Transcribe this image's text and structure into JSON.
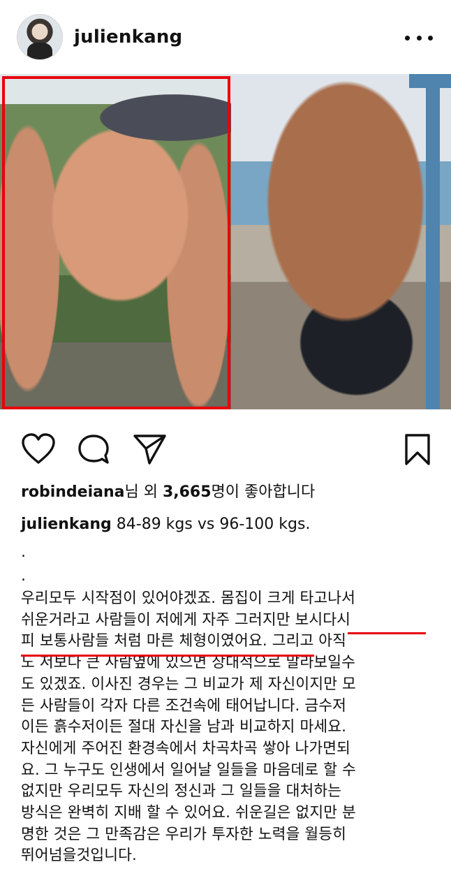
{
  "post": {
    "username": "julienkang",
    "more_icon": "more-horizontal-icon"
  },
  "photos": {
    "left_alt": "before",
    "right_alt": "after",
    "highlight_color": "#e8000c"
  },
  "actions": {
    "like_icon": "heart-outline-icon",
    "comment_icon": "comment-bubble-icon",
    "share_icon": "paper-plane-icon",
    "save_icon": "bookmark-outline-icon"
  },
  "likes": {
    "user": "robindeiana",
    "middle": "님 외 ",
    "count": "3,665",
    "suffix": "명이 좋아합니다"
  },
  "caption": {
    "author": "julienkang",
    "text": "84-89 kgs vs 96-100 kgs.",
    "dot1": ".",
    "dot2": ".",
    "lines": [
      "우리모두 시작점이 있어야겠죠. 몸집이 크게 타고나서",
      "쉬운거라고 사람들이 저에게 자주 그러지만 보시다시",
      "피 보통사람들 처럼 마른 체형이였어요. 그리고 아직",
      "도 저보다 큰 사람옆에 있으면 상대적으로 말라보일수",
      "도 있겠죠. 이사진 경우는 그 비교가 제 자신이지만 모",
      "든 사람들이 각자 다른 조건속에 태어납니다. 금수저",
      "이든 흙수저이든 절대 자신을 남과 비교하지 마세요.",
      "자신에게 주어진 환경속에서 차곡차곡 쌓아 나가면되",
      "요. 그 누구도 인생에서 일어날 일들을 마음데로 할 수",
      "없지만 우리모두 자신의 정신과 그 일들을 대처하는",
      "방식은 완벽히 지배 할 수 있어요. 쉬운길은 없지만 분",
      "명한 것은 그  만족감은 우리가 투자한 노력을 월등히",
      "뛰어넘을것입니다."
    ]
  }
}
